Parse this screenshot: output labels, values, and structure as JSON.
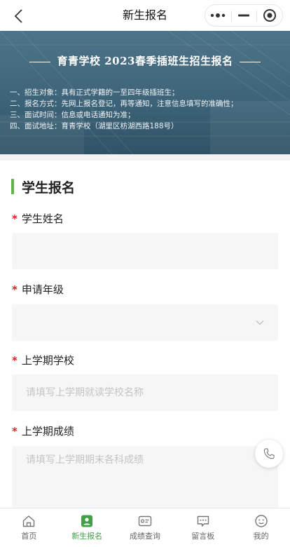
{
  "nav": {
    "title": "新生报名"
  },
  "banner": {
    "title": "育青学校  2023春季插班生招生报名",
    "lines": [
      "一、招生对象：具有正式学籍的一至四年级插班生；",
      "二、报名方式：先网上报名登记，再等通知，注意信息填写的准确性；",
      "三、面试时间：信息或电话通知为准；",
      "四、面试地址：育青学校（湖里区枋湖西路188号）"
    ]
  },
  "form": {
    "section_title": "学生报名",
    "required_mark": "*",
    "fields": [
      {
        "label": "学生姓名",
        "value": "",
        "placeholder": ""
      },
      {
        "label": "申请年级",
        "value": "",
        "placeholder": ""
      },
      {
        "label": "上学期学校",
        "value": "",
        "placeholder": "请填写上学期就读学校名称"
      },
      {
        "label": "上学期成绩",
        "value": "",
        "placeholder": "请填写上学期期末各科成绩"
      }
    ]
  },
  "tabs": [
    {
      "label": "首页",
      "icon": "home-icon",
      "active": false
    },
    {
      "label": "新生报名",
      "icon": "enroll-icon",
      "active": true
    },
    {
      "label": "成绩查询",
      "icon": "id-card-icon",
      "active": false
    },
    {
      "label": "留言板",
      "icon": "message-icon",
      "active": false
    },
    {
      "label": "我的",
      "icon": "profile-icon",
      "active": false
    }
  ],
  "colors": {
    "accent": "#43a047",
    "section_bar": "#5fb34a",
    "required": "#e02020",
    "banner_bg": "#3e6479"
  }
}
